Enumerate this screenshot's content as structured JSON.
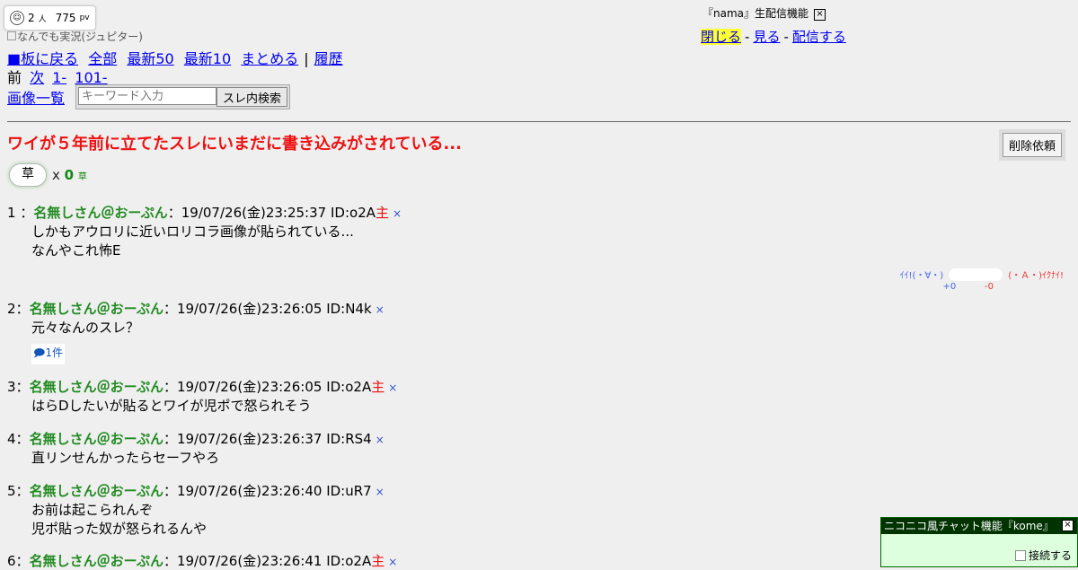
{
  "counter": {
    "people": "2",
    "people_unit": "人",
    "pv": "775",
    "pv_unit": "pv"
  },
  "board_name": "なんでも実況(ジュピター)",
  "nav": {
    "back_board": "■板に戻る",
    "all": "全部",
    "latest50": "最新50",
    "latest10": "最新10",
    "matome": "まとめる",
    "pipe": "|",
    "history": "履歴",
    "prev": "前",
    "next": "次",
    "range1": "1-",
    "range101": "101-",
    "images": "画像一覧"
  },
  "search": {
    "placeholder": "キーワード入力",
    "button": "スレ内検索"
  },
  "nama": {
    "title": "『nama』生配信機能",
    "close_x": "×",
    "close": "閉じる",
    "sep": "-",
    "watch": "見る",
    "broadcast": "配信する"
  },
  "thread": {
    "title": "ワイが５年前に立てたスレにいまだに書き込みがされている...",
    "delete_button": "削除依頼"
  },
  "kusa": {
    "button": "草",
    "x": "x",
    "count": "0",
    "unit": "草"
  },
  "vote": {
    "good_label": "ｲｲ!(・∀・)",
    "bad_label": "(・Ａ・)ｲｸﾅｲ!",
    "good_count": "+0",
    "bad_count": "-0"
  },
  "posts": [
    {
      "num": "1",
      "sep": "：",
      "name": "名無しさん＠おーぷん",
      "date": "：19/07/26(金)23:25:37",
      "id": "ID:o2A",
      "nushi": "主",
      "del": "×",
      "body": [
        "しかもアウロリに近いロリコラ画像が貼られている...",
        "なんやこれ怖E"
      ]
    },
    {
      "num": "2",
      "sep": "：",
      "name": "名無しさん＠おーぷん",
      "date": "：19/07/26(金)23:26:05",
      "id": "ID:N4k",
      "nushi": "",
      "del": "×",
      "body": [
        "元々なんのスレ？"
      ]
    },
    {
      "num": "3",
      "sep": "：",
      "name": "名無しさん＠おーぷん",
      "date": "：19/07/26(金)23:26:05",
      "id": "ID:o2A",
      "nushi": "主",
      "del": "×",
      "body": [
        "はらDしたいが貼るとワイが児ポで怒られそう"
      ]
    },
    {
      "num": "4",
      "sep": "：",
      "name": "名無しさん＠おーぷん",
      "date": "：19/07/26(金)23:26:37",
      "id": "ID:RS4",
      "nushi": "",
      "del": "×",
      "body": [
        "直リンせんかったらセーフやろ"
      ]
    },
    {
      "num": "5",
      "sep": "：",
      "name": "名無しさん＠おーぷん",
      "date": "：19/07/26(金)23:26:40",
      "id": "ID:uR7",
      "nushi": "",
      "del": "×",
      "body": [
        "お前は起こられんぞ",
        "児ポ貼った奴が怒られるんや"
      ]
    },
    {
      "num": "6",
      "sep": "：",
      "name": "名無しさん＠おーぷん",
      "date": "：19/07/26(金)23:26:41",
      "id": "ID:o2A",
      "nushi": "主",
      "del": "×",
      "body": []
    }
  ],
  "reply_count": "1件",
  "chat": {
    "title": "ニコニコ風チャット機能『kome』",
    "close_x": "×",
    "connect": "接続する"
  }
}
